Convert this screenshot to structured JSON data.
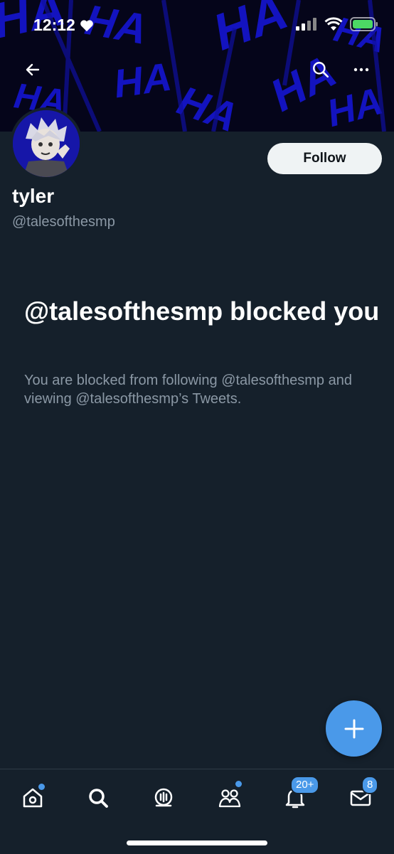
{
  "status_bar": {
    "time": "12:12"
  },
  "banner": {
    "pattern_text": "HA"
  },
  "profile": {
    "name": "tyler",
    "handle": "@talesofthesmp",
    "follow_label": "Follow"
  },
  "blocked": {
    "title": "@talesofthesmp blocked you",
    "description": "You are blocked from following @talesofthesmp and viewing @talesofthesmp’s Tweets."
  },
  "tabbar": {
    "items": [
      {
        "icon": "home-icon",
        "has_dot": true
      },
      {
        "icon": "search-icon"
      },
      {
        "icon": "spaces-icon"
      },
      {
        "icon": "communities-icon",
        "has_dot": true
      },
      {
        "icon": "notifications-icon",
        "badge": "20+"
      },
      {
        "icon": "messages-icon",
        "badge": "8"
      }
    ]
  },
  "colors": {
    "background": "#15202b",
    "accent": "#4a99e9",
    "secondary_text": "#8b98a5",
    "banner_blue": "#1414c8"
  }
}
